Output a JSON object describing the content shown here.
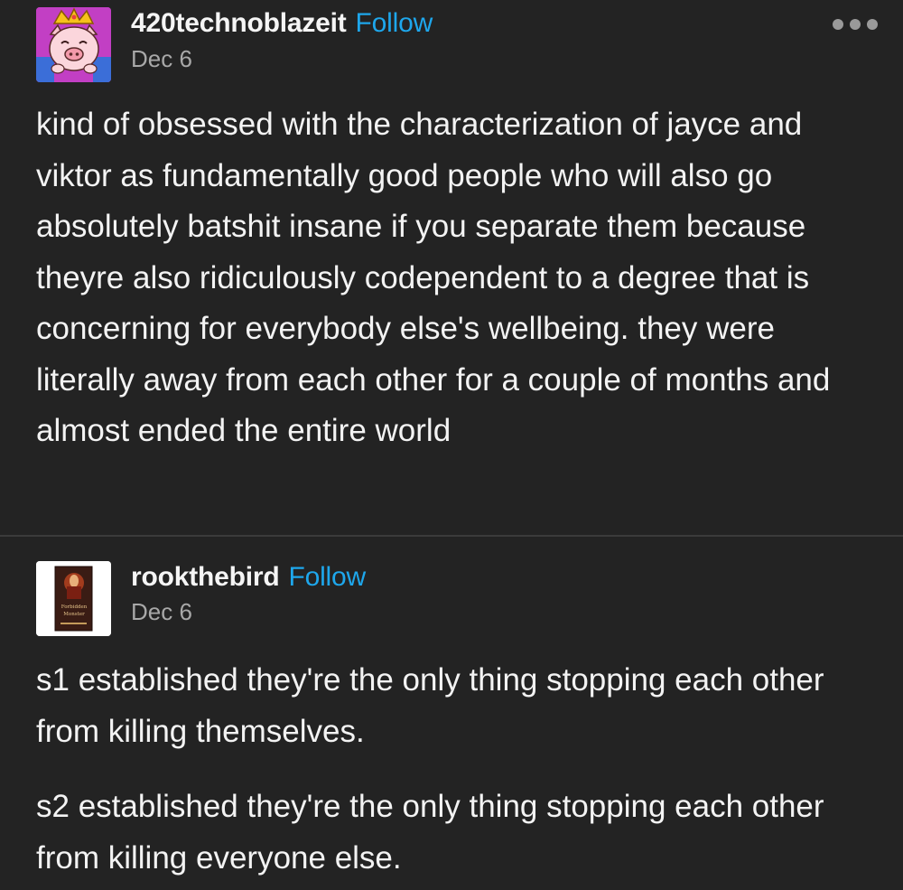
{
  "posts": [
    {
      "username": "420technoblazeit",
      "follow_label": "Follow",
      "date": "Dec 6",
      "avatar_icon": "pig-with-crown-avatar",
      "paragraphs": [
        "kind of obsessed with the characterization of jayce and viktor as fundamentally good people who will also go absolutely batshit insane if you separate them because theyre also ridiculously codependent to a degree that is concerning for everybody else's wellbeing. they were literally away from each other for a couple of months and almost ended the entire world"
      ]
    },
    {
      "username": "rookthebird",
      "follow_label": "Follow",
      "date": "Dec 6",
      "avatar_icon": "book-cover-avatar",
      "avatar_text": [
        "Forbidden",
        "Monster"
      ],
      "paragraphs": [
        "s1 established they're the only thing stopping each other from killing themselves.",
        "s2 established they're the only thing stopping each other from killing everyone else."
      ]
    }
  ],
  "colors": {
    "background": "#232323",
    "follow": "#1ea7ec",
    "date": "#a8a8a8",
    "divider": "#3b3b3b"
  }
}
